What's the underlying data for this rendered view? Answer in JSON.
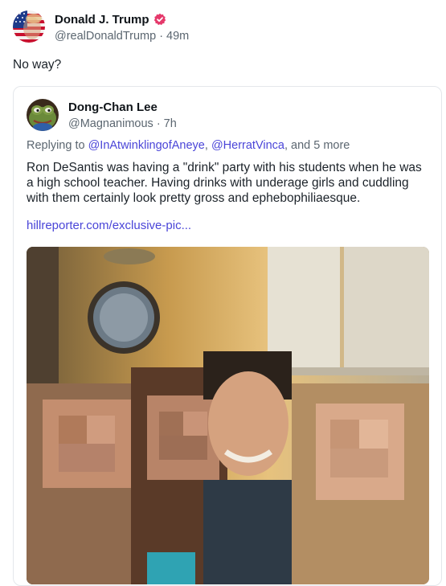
{
  "post": {
    "author": {
      "display_name": "Donald J. Trump",
      "handle": "@realDonaldTrump",
      "verified": true,
      "verified_color": "#e5396b",
      "avatar_icon": "flag-avatar"
    },
    "separator": "·",
    "time": "49m",
    "text": "No way?"
  },
  "quote": {
    "author": {
      "display_name": "Dong-Chan Lee",
      "handle": "@Magnanimous",
      "avatar_icon": "frog-avatar"
    },
    "separator": "·",
    "time": "7h",
    "replying_prefix": "Replying to",
    "mentions": [
      "@InAtwinklingofAneye",
      "@HerratVinca"
    ],
    "mention_sep": ",",
    "replying_suffix": ", and 5 more",
    "body": "Ron DeSantis was having a \"drink\" party with his students when he was a high school teacher. Having drinks with underage girls and cuddling with them certainly look pretty gross and ephebophiliaesque.",
    "link": "hillreporter.com/exclusive-pic...",
    "image_icon": "group-photo-pixelated"
  },
  "colors": {
    "link": "#4a45d8",
    "muted": "#5b6670",
    "border": "#e4e7eb"
  }
}
